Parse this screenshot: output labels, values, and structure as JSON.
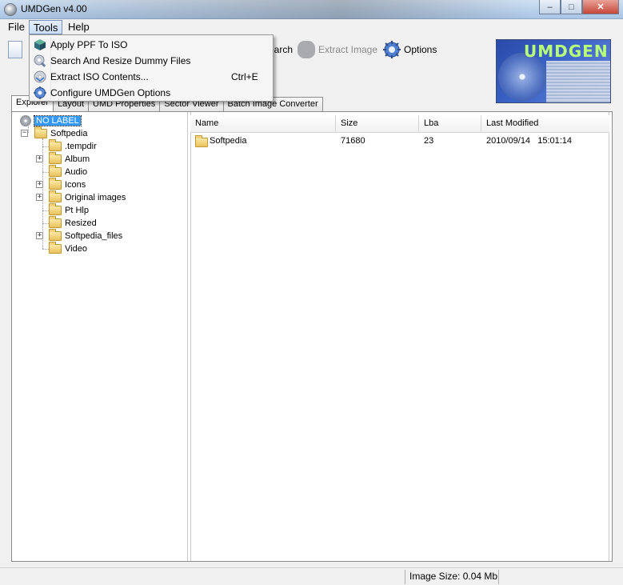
{
  "window": {
    "title": "UMDGen v4.00",
    "controls": [
      "–",
      "□",
      "✕"
    ]
  },
  "menubar": {
    "items": [
      "File",
      "Tools",
      "Help"
    ]
  },
  "toolbar": {
    "search_label": "earch",
    "extract_image_label": "Extract Image",
    "options_label": "Options"
  },
  "logo": {
    "text": "UMDGEN"
  },
  "tabs": [
    "Explorer",
    "Layout",
    "UMD Properties",
    "Sector Viewer",
    "Batch Image Converter"
  ],
  "tree": {
    "root": "NO LABEL",
    "folder": "Softpedia",
    "children": [
      ".tempdir",
      "Album",
      "Audio",
      "Icons",
      "Original images",
      "Pt Hlp",
      "Resized",
      "Softpedia_files",
      "Video"
    ]
  },
  "list": {
    "columns": [
      "Name",
      "Size",
      "Lba",
      "Last Modified"
    ],
    "rows": [
      {
        "name": "Softpedia",
        "size": "71680",
        "lba": "23",
        "modified": "2010/09/14   15:01:14"
      }
    ]
  },
  "status": {
    "image_size": "Image Size: 0.04 Mb"
  },
  "tools_menu": {
    "items": [
      {
        "label": "Apply PPF To ISO",
        "shortcut": "",
        "icon": "cube-icon"
      },
      {
        "label": "Search And Resize Dummy Files",
        "shortcut": "",
        "icon": "search-disc-icon"
      },
      {
        "label": "Extract ISO Contents...",
        "shortcut": "Ctrl+E",
        "icon": "disc-icon"
      },
      {
        "label": "Configure UMDGen Options",
        "shortcut": "",
        "icon": "gear-icon"
      }
    ]
  },
  "colors": {
    "selection": "#3399ff",
    "logo_text": "#b8ff7a",
    "menu_highlight": "#cadcf4"
  }
}
